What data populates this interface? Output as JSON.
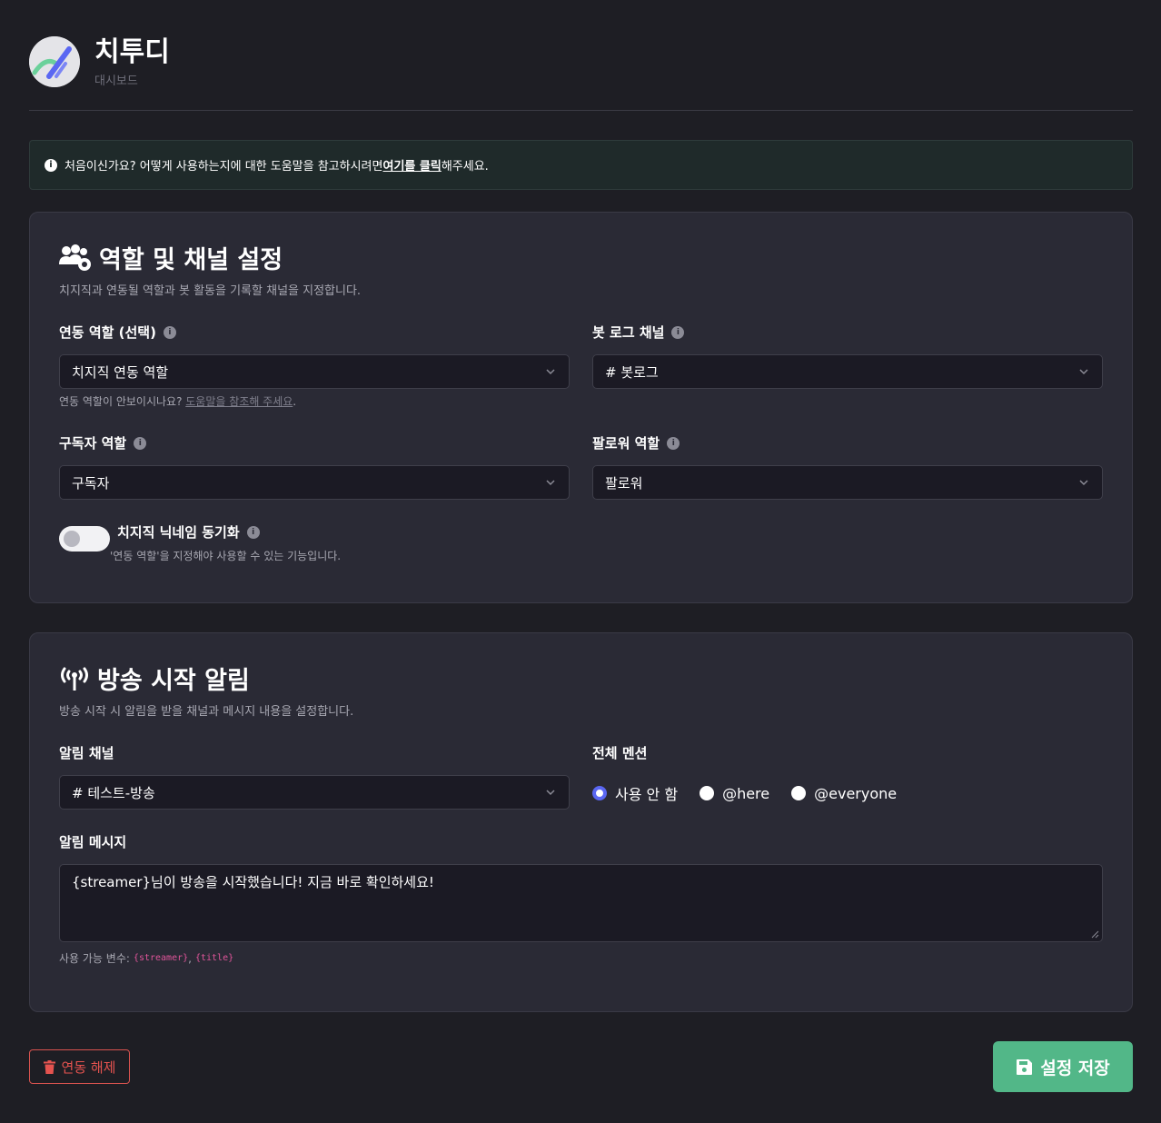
{
  "app": {
    "title": "치투디",
    "subtitle": "대시보드"
  },
  "notice": {
    "text_before": "처음이신가요? 어떻게 사용하는지에 대한 도움말을 참고하시려면 ",
    "link": "여기를 클릭",
    "text_after": "해주세요."
  },
  "role_section": {
    "title": "역할 및 채널 설정",
    "description": "치지직과 연동될 역할과 봇 활동을 기록할 채널을 지정합니다.",
    "linked_role": {
      "label": "연동 역할 (선택)",
      "value": "치지직 연동 역할",
      "hint_text": "연동 역할이 안보이시나요? ",
      "hint_link": "도움말을 참조해 주세요",
      "hint_end": "."
    },
    "bot_log_channel": {
      "label": "봇 로그 채널",
      "value": "# 봇로그"
    },
    "subscriber_role": {
      "label": "구독자 역할",
      "value": "구독자"
    },
    "follower_role": {
      "label": "팔로워 역할",
      "value": "팔로워"
    },
    "nickname_sync": {
      "label": "치지직 닉네임 동기화",
      "hint": "'연동 역할'을 지정해야 사용할 수 있는 기능입니다.",
      "enabled": false
    }
  },
  "broadcast_section": {
    "title": "방송 시작 알림",
    "description": "방송 시작 시 알림을 받을 채널과 메시지 내용을 설정합니다.",
    "alert_channel": {
      "label": "알림 채널",
      "value": "# 테스트-방송"
    },
    "mention": {
      "label": "전체 멘션",
      "options": [
        "사용 안 함",
        "@here",
        "@everyone"
      ],
      "selected": "사용 안 함"
    },
    "message": {
      "label": "알림 메시지",
      "value": "{streamer}님이 방송을 시작했습니다! 지금 바로 확인하세요!",
      "vars_label": "사용 가능 변수:",
      "vars": [
        "{streamer}",
        "{title}"
      ]
    }
  },
  "actions": {
    "unlink": "연동 해제",
    "save": "설정 저장"
  },
  "colors": {
    "background": "#1e1e24",
    "card": "#2a2a35",
    "save_button": "#52b788",
    "unlink_button": "#e5534f",
    "radio_accent": "#5a67f2",
    "variable_code": "#e0559a"
  }
}
